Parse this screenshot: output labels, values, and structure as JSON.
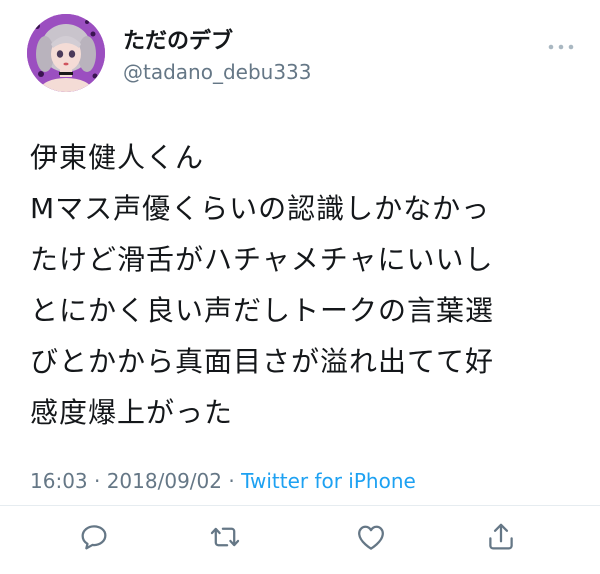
{
  "tweet": {
    "author": {
      "display_name": "ただのデブ",
      "handle": "@tadano_debu333"
    },
    "text_lines": [
      "伊東健人くん",
      "Mマス声優くらいの認識しかなかっ",
      "たけど滑舌がハチャメチャにいいし",
      "とにかく良い声だしトークの言葉選",
      "びとかから真面目さが溢れ出てて好",
      "感度爆上がった"
    ],
    "timestamp": "16:03 · 2018/09/02 · ",
    "source": "Twitter for iPhone"
  },
  "actions": {
    "reply_icon": "reply-icon",
    "retweet_icon": "retweet-icon",
    "like_icon": "heart-icon",
    "share_icon": "share-icon"
  },
  "colors": {
    "text": "#14171a",
    "secondary": "#657786",
    "accent": "#1da1f2",
    "divider": "#e6ecf0"
  }
}
